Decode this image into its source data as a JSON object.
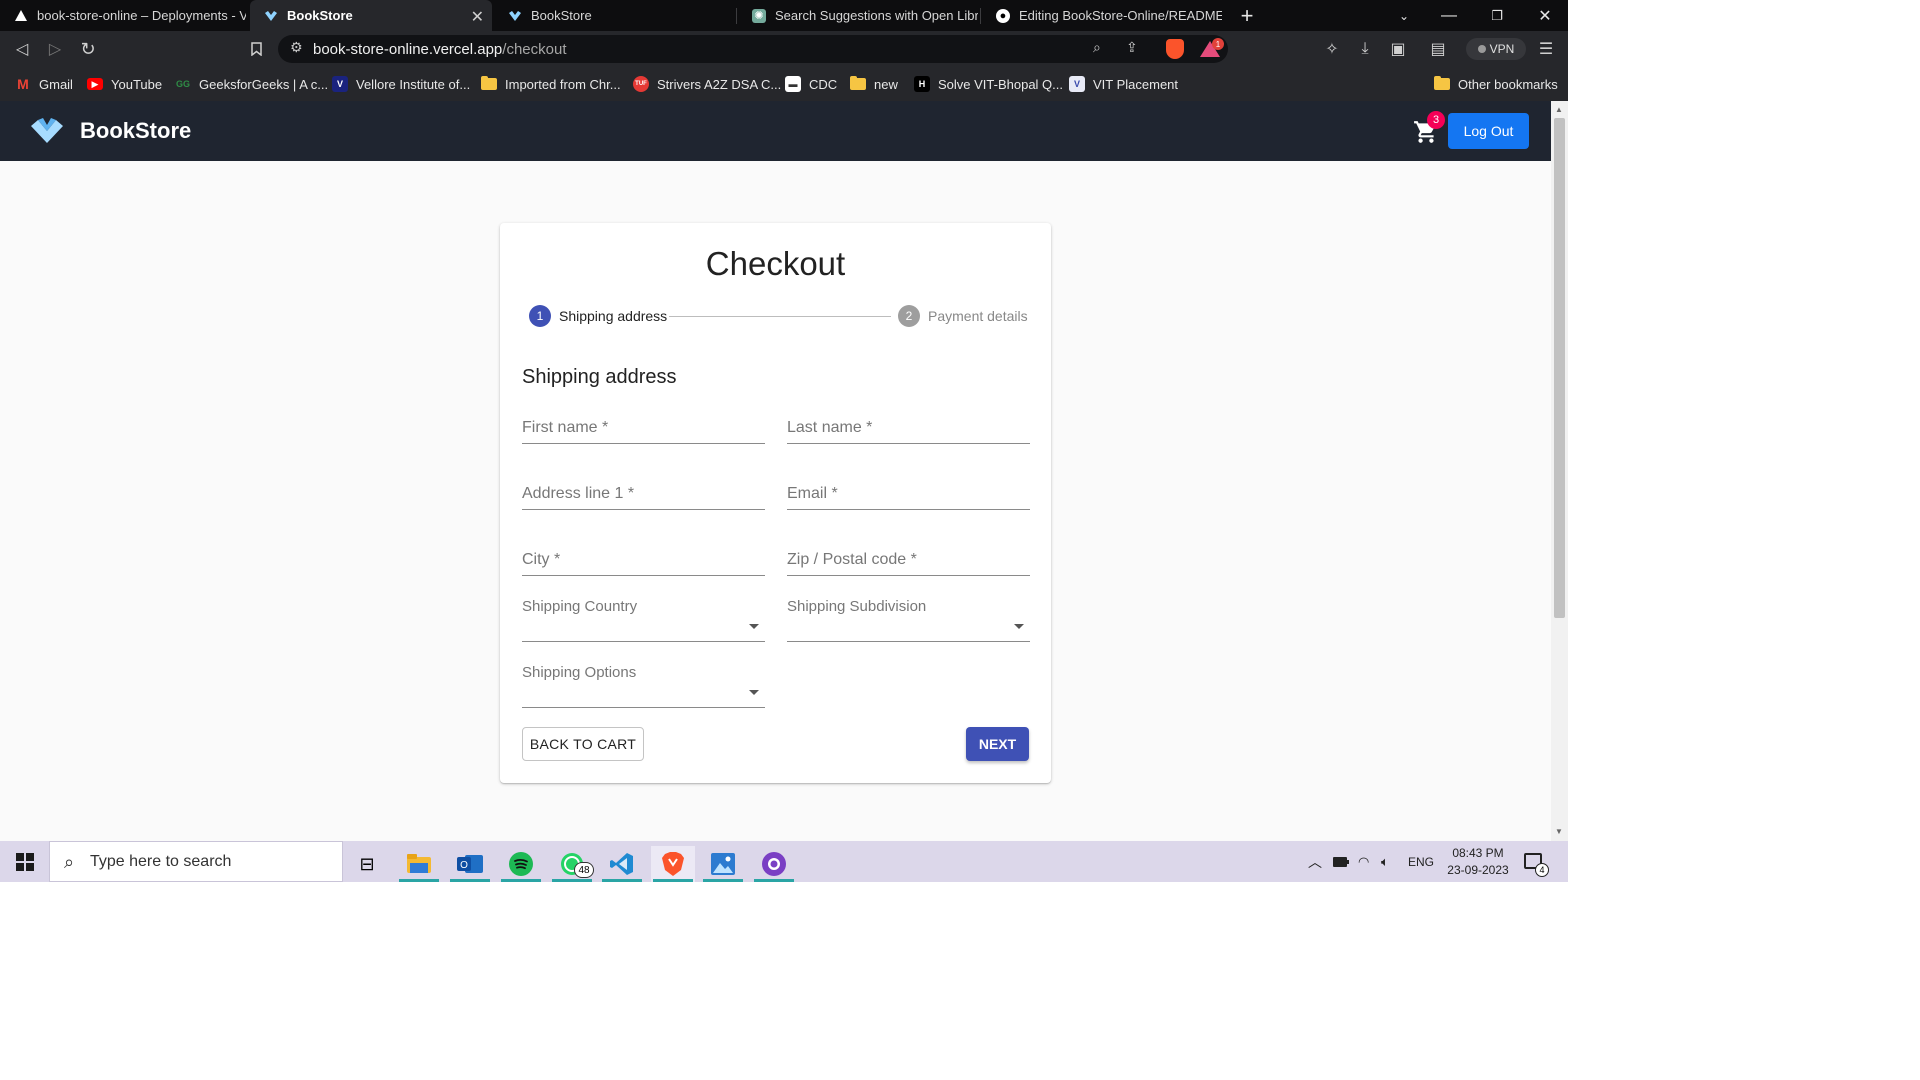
{
  "browser": {
    "tabs": [
      {
        "title": "book-store-online – Deployments - Ve",
        "icon": "vercel-triangle-icon",
        "active": false
      },
      {
        "title": "BookStore",
        "icon": "bookstore-icon",
        "active": true
      },
      {
        "title": "BookStore",
        "icon": "bookstore-icon",
        "active": false
      },
      {
        "title": "Search Suggestions with Open Library",
        "icon": "openai-icon",
        "active": false
      },
      {
        "title": "Editing BookStore-Online/README.md",
        "icon": "github-icon",
        "active": false
      }
    ],
    "new_tab": "+",
    "url_host": "book-store-online.vercel.app",
    "url_path": "/checkout",
    "reward_count": "1",
    "vpn_label": "VPN"
  },
  "bookmarks": [
    {
      "label": "Gmail",
      "icon": "gmail-icon"
    },
    {
      "label": "YouTube",
      "icon": "youtube-icon"
    },
    {
      "label": "GeeksforGeeks | A c...",
      "icon": "gfg-icon"
    },
    {
      "label": "Vellore Institute of...",
      "icon": "vit-icon"
    },
    {
      "label": "Imported from Chr...",
      "icon": "folder-icon"
    },
    {
      "label": "Strivers A2Z DSA C...",
      "icon": "tuf-icon"
    },
    {
      "label": "CDC",
      "icon": "cdc-icon"
    },
    {
      "label": "new",
      "icon": "folder-icon"
    },
    {
      "label": "Solve VIT-Bhopal Q...",
      "icon": "hackerrank-icon"
    },
    {
      "label": "VIT Placement",
      "icon": "vit-placement-icon"
    }
  ],
  "other_bookmarks": "Other bookmarks",
  "app": {
    "brand": "BookStore",
    "cart_count": "3",
    "logout_label": "Log Out"
  },
  "checkout": {
    "title": "Checkout",
    "steps": [
      {
        "number": "1",
        "label": "Shipping address",
        "active": true
      },
      {
        "number": "2",
        "label": "Payment details",
        "active": false
      }
    ],
    "section_title": "Shipping address",
    "fields": {
      "first_name": "First name *",
      "last_name": "Last name *",
      "address1": "Address line 1 *",
      "email": "Email *",
      "city": "City *",
      "zip": "Zip / Postal code *"
    },
    "selects": {
      "country": "Shipping Country",
      "subdivision": "Shipping Subdivision",
      "options": "Shipping Options"
    },
    "back_label": "BACK TO CART",
    "next_label": "NEXT"
  },
  "taskbar": {
    "search_placeholder": "Type here to search",
    "whatsapp_badge": "48",
    "language": "ENG",
    "time": "08:43 PM",
    "date": "23-09-2023",
    "notification_count": "4"
  },
  "colors": {
    "primary": "#3f51b5",
    "logout": "#1476f2",
    "header": "#1f2530",
    "cart_badge": "#f50057"
  }
}
